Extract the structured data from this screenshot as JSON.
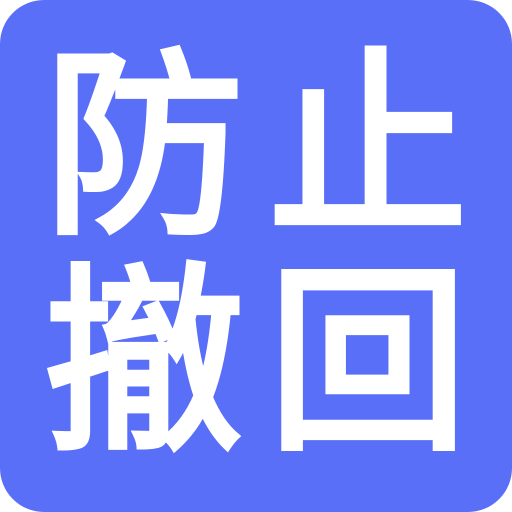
{
  "icon": {
    "background_color": "#5a6ff7",
    "text_color": "#ffffff",
    "characters": [
      "防",
      "止",
      "撤",
      "回"
    ]
  }
}
